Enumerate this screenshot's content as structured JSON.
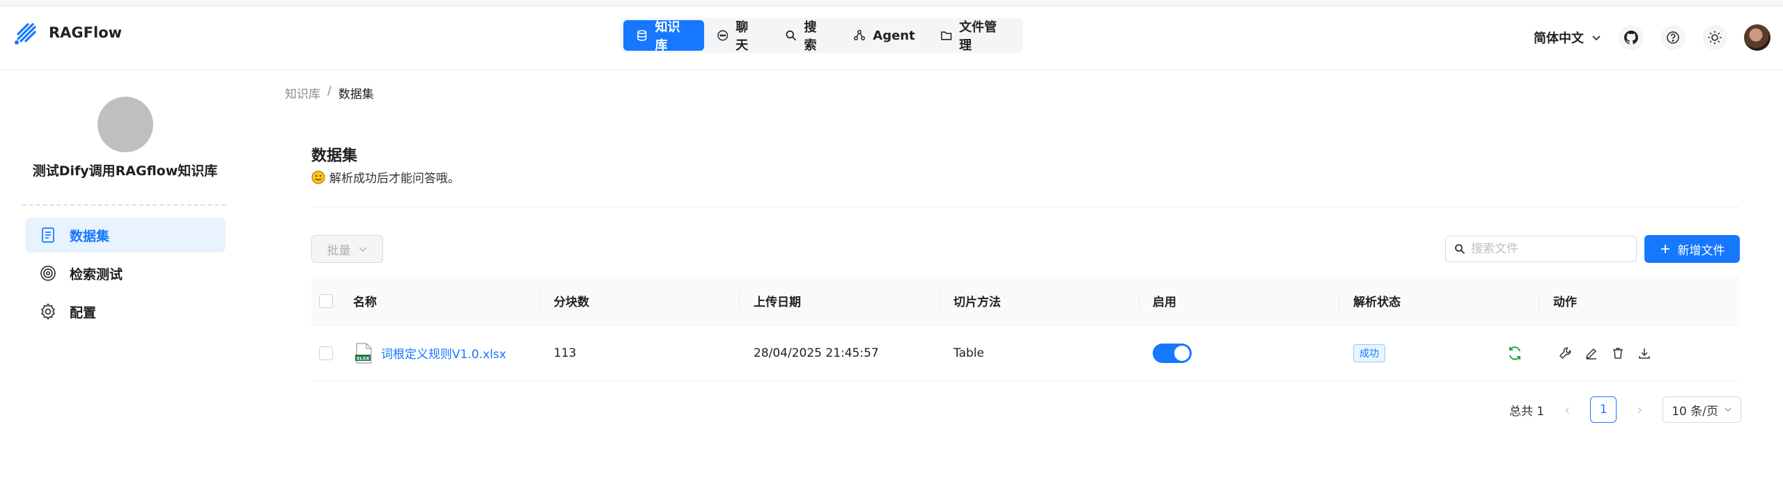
{
  "app": {
    "name": "RAGFlow"
  },
  "nav": [
    {
      "label": "知识库",
      "icon": "database-icon",
      "active": true
    },
    {
      "label": "聊天",
      "icon": "chat-icon",
      "active": false
    },
    {
      "label": "搜索",
      "icon": "search-icon",
      "active": false
    },
    {
      "label": "Agent",
      "icon": "agent-icon",
      "active": false
    },
    {
      "label": "文件管理",
      "icon": "folder-icon",
      "active": false
    }
  ],
  "header": {
    "language": "简体中文"
  },
  "sidebar": {
    "kb_name": "测试Dify调用RAGflow知识库",
    "items": [
      {
        "label": "数据集",
        "icon": "document-icon",
        "active": true
      },
      {
        "label": "检索测试",
        "icon": "target-icon",
        "active": false
      },
      {
        "label": "配置",
        "icon": "gear-icon",
        "active": false
      }
    ]
  },
  "breadcrumb": {
    "root": "知识库",
    "separator": "/",
    "current": "数据集"
  },
  "page": {
    "title": "数据集",
    "description": "解析成功后才能问答哦。"
  },
  "toolbar": {
    "batch_label": "批量",
    "search_placeholder": "搜索文件",
    "add_label": "新增文件"
  },
  "table": {
    "columns": [
      "名称",
      "分块数",
      "上传日期",
      "切片方法",
      "启用",
      "解析状态",
      "动作"
    ],
    "rows": [
      {
        "name": "词根定义规则V1.0.xlsx",
        "file_type": "XLSX",
        "chunks": "113",
        "uploaded": "28/04/2025 21:45:57",
        "method": "Table",
        "enabled": true,
        "status": "成功"
      }
    ]
  },
  "pagination": {
    "total": "总共 1",
    "page": "1",
    "page_size": "10 条/页"
  },
  "colors": {
    "primary": "#1677ff",
    "success": "#22a745",
    "excel": "#1d7a44"
  }
}
